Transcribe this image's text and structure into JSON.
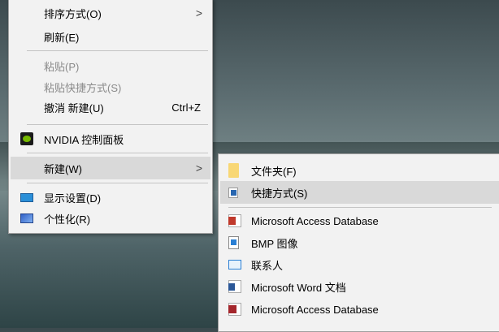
{
  "main_menu": {
    "items": [
      {
        "label": "排序方式(O)",
        "submenu": true
      },
      {
        "label": "刷新(E)"
      },
      {
        "label": "粘贴(P)",
        "disabled": true
      },
      {
        "label": "粘贴快捷方式(S)",
        "disabled": true
      },
      {
        "label": "撤消 新建(U)",
        "shortcut": "Ctrl+Z"
      },
      {
        "label": "NVIDIA 控制面板",
        "icon": "nvidia-icon"
      },
      {
        "label": "新建(W)",
        "submenu": true,
        "highlighted": true
      },
      {
        "label": "显示设置(D)",
        "icon": "display-icon"
      },
      {
        "label": "个性化(R)",
        "icon": "personalize-icon"
      }
    ],
    "submenu_arrow": ">"
  },
  "new_submenu": {
    "items": [
      {
        "label": "文件夹(F)",
        "icon": "folder-icon"
      },
      {
        "label": "快捷方式(S)",
        "icon": "shortcut-icon",
        "highlighted": true
      },
      {
        "label": "Microsoft Access Database",
        "icon": "access-icon"
      },
      {
        "label": "BMP 图像",
        "icon": "bmp-icon"
      },
      {
        "label": "联系人",
        "icon": "contact-icon"
      },
      {
        "label": "Microsoft Word 文档",
        "icon": "word-icon"
      },
      {
        "label": "Microsoft Access Database",
        "icon": "access-icon"
      }
    ]
  }
}
